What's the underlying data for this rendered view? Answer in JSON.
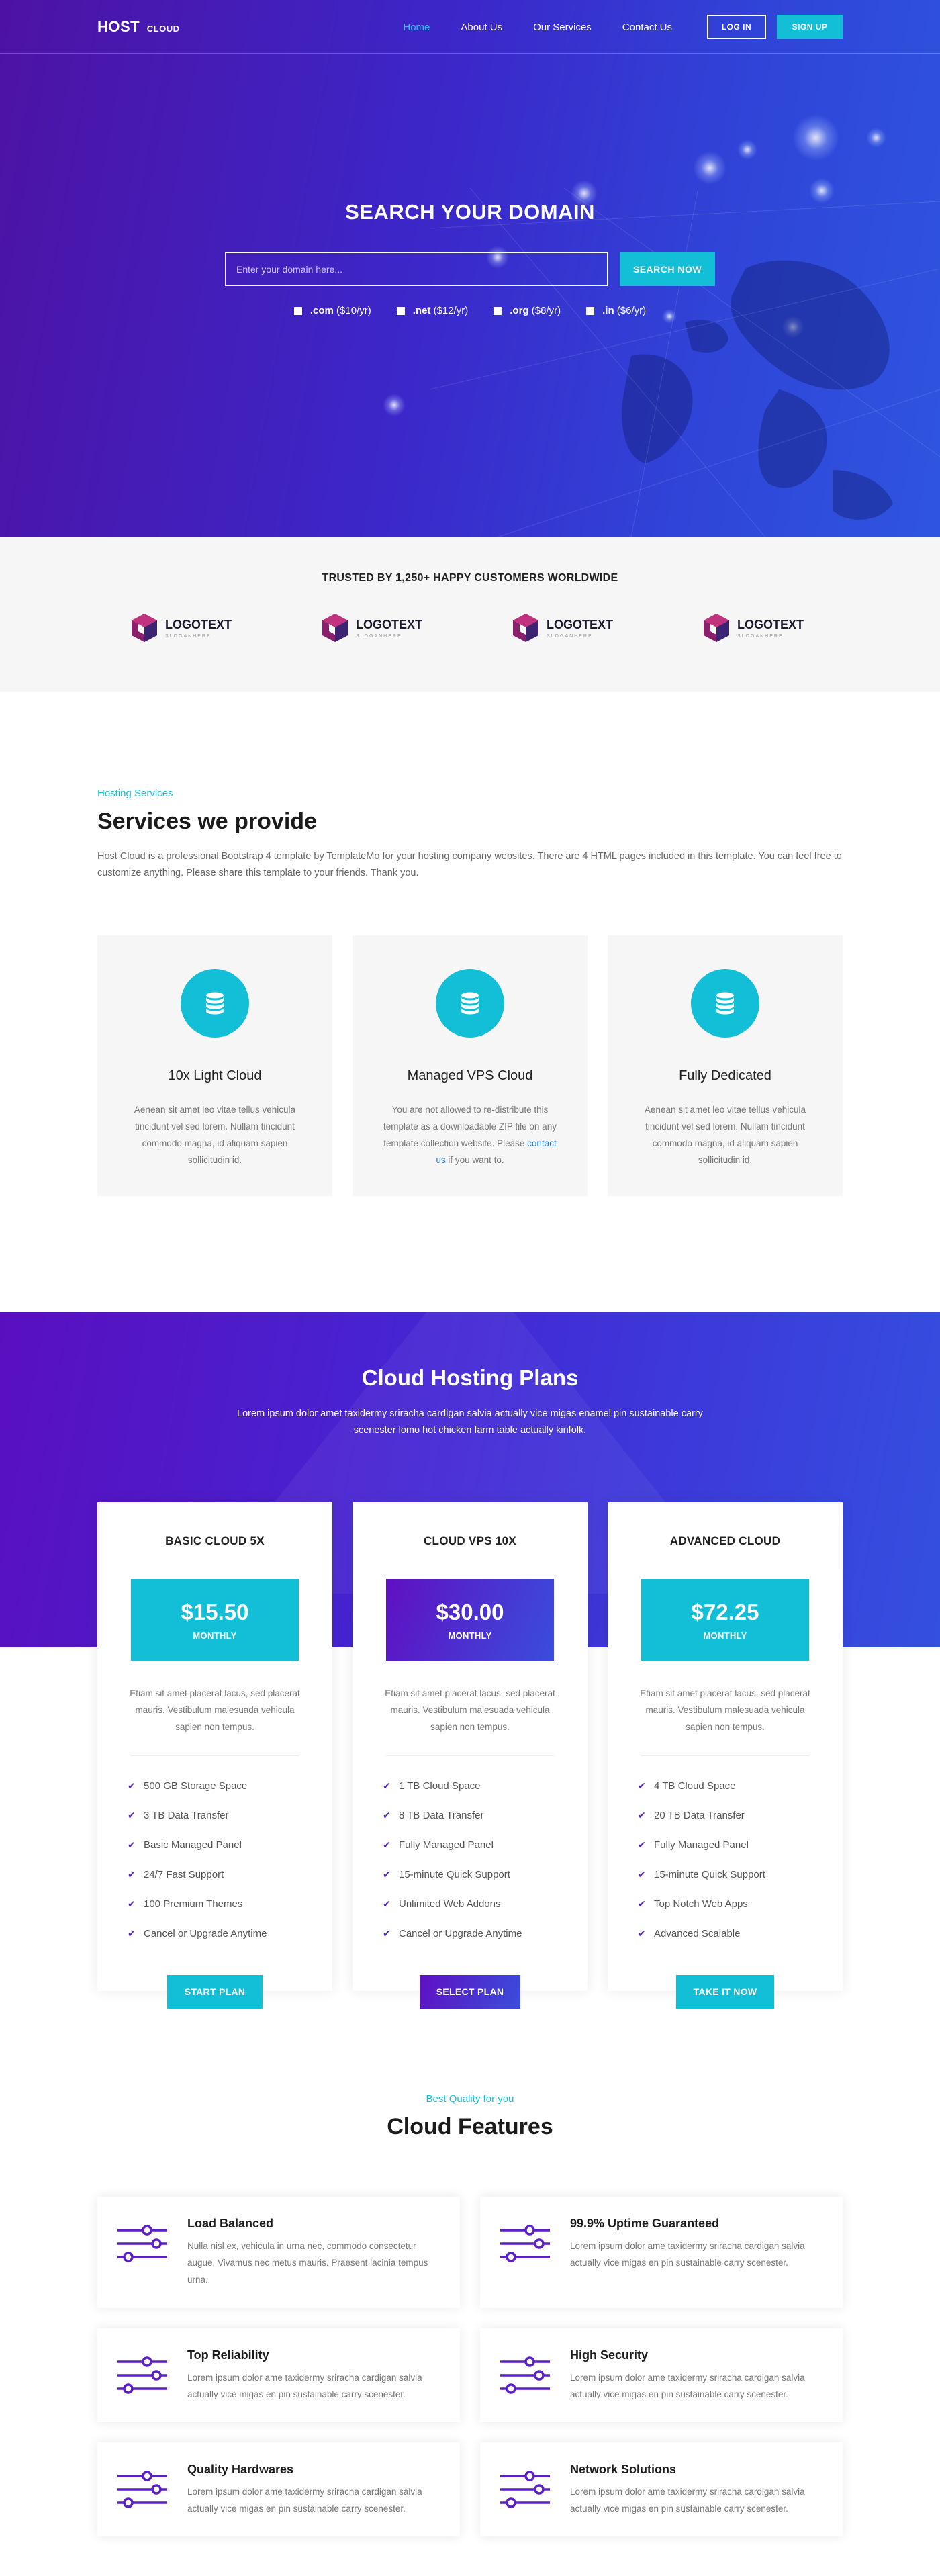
{
  "nav": {
    "logo": "HOST",
    "logo_small": "CLOUD",
    "items": [
      {
        "label": "Home",
        "active": true
      },
      {
        "label": "About Us",
        "active": false
      },
      {
        "label": "Our Services",
        "active": false
      },
      {
        "label": "Contact Us",
        "active": false
      }
    ],
    "login": "LOG IN",
    "signup": "SIGN UP"
  },
  "hero": {
    "title": "SEARCH YOUR DOMAIN",
    "placeholder": "Enter your domain here...",
    "search_button": "SEARCH NOW",
    "tlds": [
      {
        "ext": ".com",
        "price": "($10/yr)"
      },
      {
        "ext": ".net",
        "price": "($12/yr)"
      },
      {
        "ext": ".org",
        "price": "($8/yr)"
      },
      {
        "ext": ".in",
        "price": "($6/yr)"
      }
    ]
  },
  "trusted": {
    "title": "TRUSTED BY 1,250+ HAPPY CUSTOMERS WORLDWIDE",
    "logos": [
      {
        "name": "LOGOTEXT",
        "slogan": "SLOGANHERE"
      },
      {
        "name": "LOGOTEXT",
        "slogan": "SLOGANHERE"
      },
      {
        "name": "LOGOTEXT",
        "slogan": "SLOGANHERE"
      },
      {
        "name": "LOGOTEXT",
        "slogan": "SLOGANHERE"
      }
    ]
  },
  "services": {
    "eyebrow": "Hosting Services",
    "title": "Services we provide",
    "lead": "Host Cloud is a professional Bootstrap 4 template by TemplateMo for your hosting company websites. There are 4 HTML pages included in this template. You can feel free to customize anything. Please share this template to your friends. Thank you.",
    "cards": [
      {
        "title": "10x Light Cloud",
        "text": "Aenean sit amet leo vitae tellus vehicula tincidunt vel sed lorem. Nullam tincidunt commodo magna, id aliquam sapien sollicitudin id."
      },
      {
        "title": "Managed VPS Cloud",
        "text_before": "You are not allowed to re-distribute this template as a downloadable ZIP file on any template collection website. Please",
        "link": "contact us",
        "text_after": "if you want to."
      },
      {
        "title": "Fully Dedicated",
        "text": "Aenean sit amet leo vitae tellus vehicula tincidunt vel sed lorem. Nullam tincidunt commodo magna, id aliquam sapien sollicitudin id."
      }
    ]
  },
  "plans": {
    "title": "Cloud Hosting Plans",
    "subtitle": "Lorem ipsum dolor amet taxidermy sriracha cardigan salvia actually vice migas enamel pin sustainable carry scenester lomo hot chicken farm table actually kinfolk.",
    "cards": [
      {
        "name": "BASIC CLOUD 5X",
        "price": "$15.50",
        "period": "MONTHLY",
        "desc": "Etiam sit amet placerat lacus, sed placerat mauris. Vestibulum malesuada vehicula sapien non tempus.",
        "features": [
          "500 GB Storage Space",
          "3 TB Data Transfer",
          "Basic Managed Panel",
          "24/7 Fast Support",
          "100 Premium Themes",
          "Cancel or Upgrade Anytime"
        ],
        "button": "START PLAN",
        "accent": "#12bfd6"
      },
      {
        "name": "CLOUD VPS 10X",
        "price": "$30.00",
        "period": "MONTHLY",
        "desc": "Etiam sit amet placerat lacus, sed placerat mauris. Vestibulum malesuada vehicula sapien non tempus.",
        "features": [
          "1 TB Cloud Space",
          "8 TB Data Transfer",
          "Fully Managed Panel",
          "15-minute Quick Support",
          "Unlimited Web Addons",
          "Cancel or Upgrade Anytime"
        ],
        "button": "SELECT PLAN",
        "accent": "#4a2ccf"
      },
      {
        "name": "ADVANCED CLOUD",
        "price": "$72.25",
        "period": "MONTHLY",
        "desc": "Etiam sit amet placerat lacus, sed placerat mauris. Vestibulum malesuada vehicula sapien non tempus.",
        "features": [
          "4 TB Cloud Space",
          "20 TB Data Transfer",
          "Fully Managed Panel",
          "15-minute Quick Support",
          "Top Notch Web Apps",
          "Advanced Scalable"
        ],
        "button": "TAKE IT NOW",
        "accent": "#12bfd6"
      }
    ]
  },
  "features": {
    "eyebrow": "Best Quality for you",
    "title": "Cloud Features",
    "items": [
      {
        "title": "Load Balanced",
        "text": "Nulla nisl ex, vehicula in urna nec, commodo consectetur augue. Vivamus nec metus mauris. Praesent lacinia tempus urna."
      },
      {
        "title": "99.9% Uptime Guaranteed",
        "text": "Lorem ipsum dolor ame taxidermy sriracha cardigan salvia actually vice migas en pin sustainable carry scenester."
      },
      {
        "title": "Top Reliability",
        "text": "Lorem ipsum dolor ame taxidermy sriracha cardigan salvia actually vice migas en pin sustainable carry scenester."
      },
      {
        "title": "High Security",
        "text": "Lorem ipsum dolor ame taxidermy sriracha cardigan salvia actually vice migas en pin sustainable carry scenester."
      },
      {
        "title": "Quality Hardwares",
        "text": "Lorem ipsum dolor ame taxidermy sriracha cardigan salvia actually vice migas en pin sustainable carry scenester."
      },
      {
        "title": "Network Solutions",
        "text": "Lorem ipsum dolor ame taxidermy sriracha cardigan salvia actually vice migas en pin sustainable carry scenester."
      }
    ]
  },
  "colors": {
    "accent": "#12bfd6",
    "purple": "#5222c4",
    "brand_gradient_start": "#6010c2",
    "brand_gradient_end": "#3a4ddd"
  }
}
